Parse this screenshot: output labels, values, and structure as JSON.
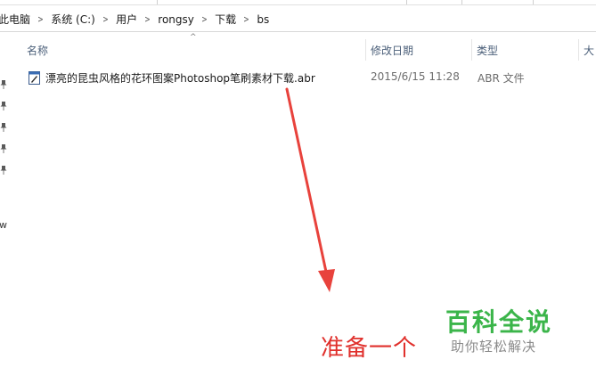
{
  "address_bar": {
    "crumbs": [
      "此电脑",
      "系统 (C:)",
      "用户",
      "rongsy",
      "下载",
      "bs"
    ]
  },
  "nav_pane": {
    "partial_label": "w"
  },
  "columns": {
    "name": "名称",
    "date_modified": "修改日期",
    "type": "类型",
    "size": "大"
  },
  "files": [
    {
      "name": "漂亮的昆虫风格的花环图案Photoshop笔刷素材下载.abr",
      "date_modified": "2015/6/15 11:28",
      "type": "ABR 文件",
      "icon": "document-icon"
    }
  ],
  "annotation": {
    "text": "准备一个",
    "color": "#e0302c"
  },
  "watermark": {
    "title": "百科全说",
    "subtitle": "助你轻松解决",
    "color": "#3bb54a"
  },
  "colors": {
    "header_text": "#4c607a",
    "meta_text": "#6d6d6d"
  }
}
